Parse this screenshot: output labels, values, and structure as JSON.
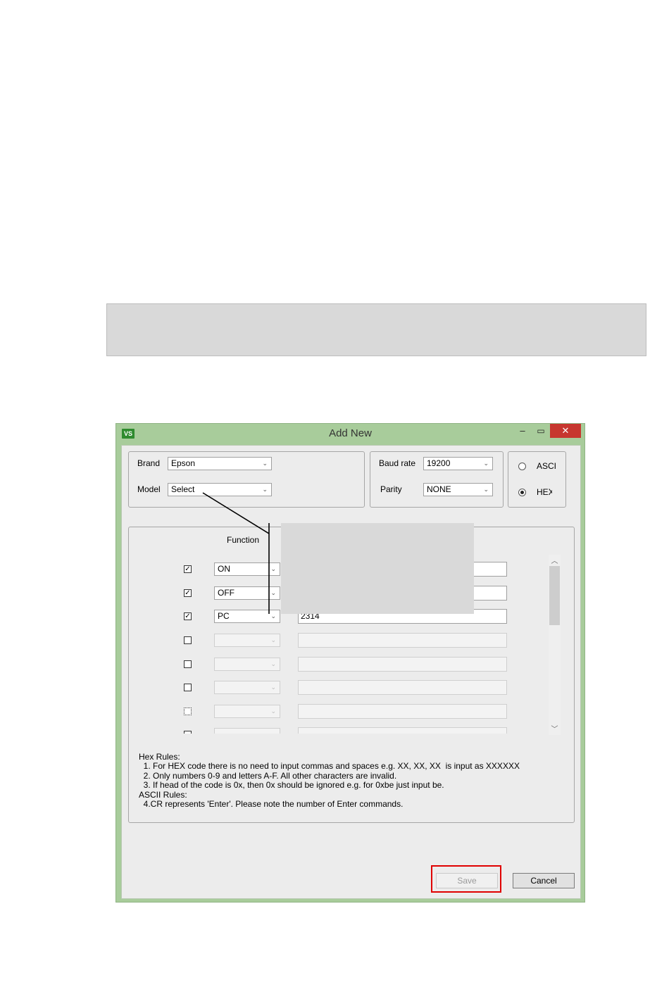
{
  "window": {
    "title": "Add New",
    "logo_text": "VS",
    "minimize_glyph": "–",
    "maximize_glyph": "▭",
    "close_glyph": "✕"
  },
  "device": {
    "brand_label": "Brand",
    "brand_value": "Epson",
    "model_label": "Model",
    "model_value": "Select"
  },
  "serial": {
    "baud_label": "Baud rate",
    "baud_value": "19200",
    "parity_label": "Parity",
    "parity_value": "NONE"
  },
  "mode": {
    "ascii_label": "ASCI",
    "hex_label": "HEX",
    "selected": "HEX"
  },
  "commands": {
    "header_function": "Function",
    "rows": [
      {
        "checked": true,
        "function": "ON",
        "code": ""
      },
      {
        "checked": true,
        "function": "OFF",
        "code": ""
      },
      {
        "checked": true,
        "function": "PC",
        "code": "2314"
      },
      {
        "checked": false,
        "function": "",
        "code": ""
      },
      {
        "checked": false,
        "function": "",
        "code": ""
      },
      {
        "checked": false,
        "function": "",
        "code": ""
      },
      {
        "checked": false,
        "function": "",
        "code": ""
      },
      {
        "checked": false,
        "function": "",
        "code": ""
      }
    ]
  },
  "rules": {
    "hex_title": "Hex Rules:",
    "hex_1": "  1. For HEX code there is no need to input commas and spaces e.g. XX, XX, XX  is input as XXXXXX",
    "hex_2": "  2. Only numbers 0-9 and letters A-F. All other characters are invalid.",
    "hex_3": "  3. If head of the code is 0x, then 0x should be ignored e.g. for 0xbe just input be.",
    "ascii_title": "ASCII Rules:",
    "ascii_1": "  4.CR represents 'Enter'. Please note the number of Enter commands."
  },
  "buttons": {
    "save": "Save",
    "cancel": "Cancel"
  },
  "icons": {
    "checkbox_checked": "checkmark-icon",
    "dropdown": "chevron-down-icon",
    "scroll_up": "chevron-up-icon",
    "scroll_down": "chevron-down-icon"
  },
  "colors": {
    "frame": "#a8cc9b",
    "close": "#c7372f",
    "highlight": "#e00000"
  }
}
